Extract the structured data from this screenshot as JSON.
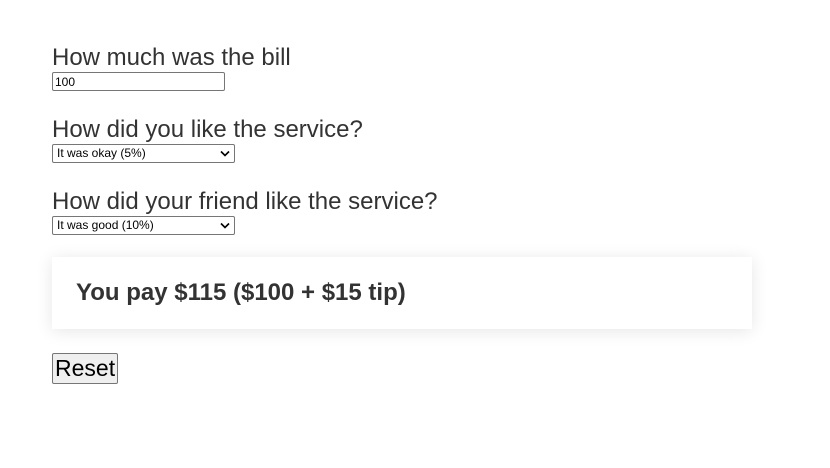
{
  "bill": {
    "label": "How much was the bill",
    "value": "100"
  },
  "service": {
    "label": "How did you like the service?",
    "selected": "It was okay (5%)"
  },
  "friend_service": {
    "label": "How did your friend like the service?",
    "selected": "It was good (10%)"
  },
  "result": {
    "text": "You pay $115 ($100 + $15 tip)"
  },
  "reset": {
    "label": "Reset"
  },
  "icons": {
    "dropdown": "chevron-down-icon"
  }
}
